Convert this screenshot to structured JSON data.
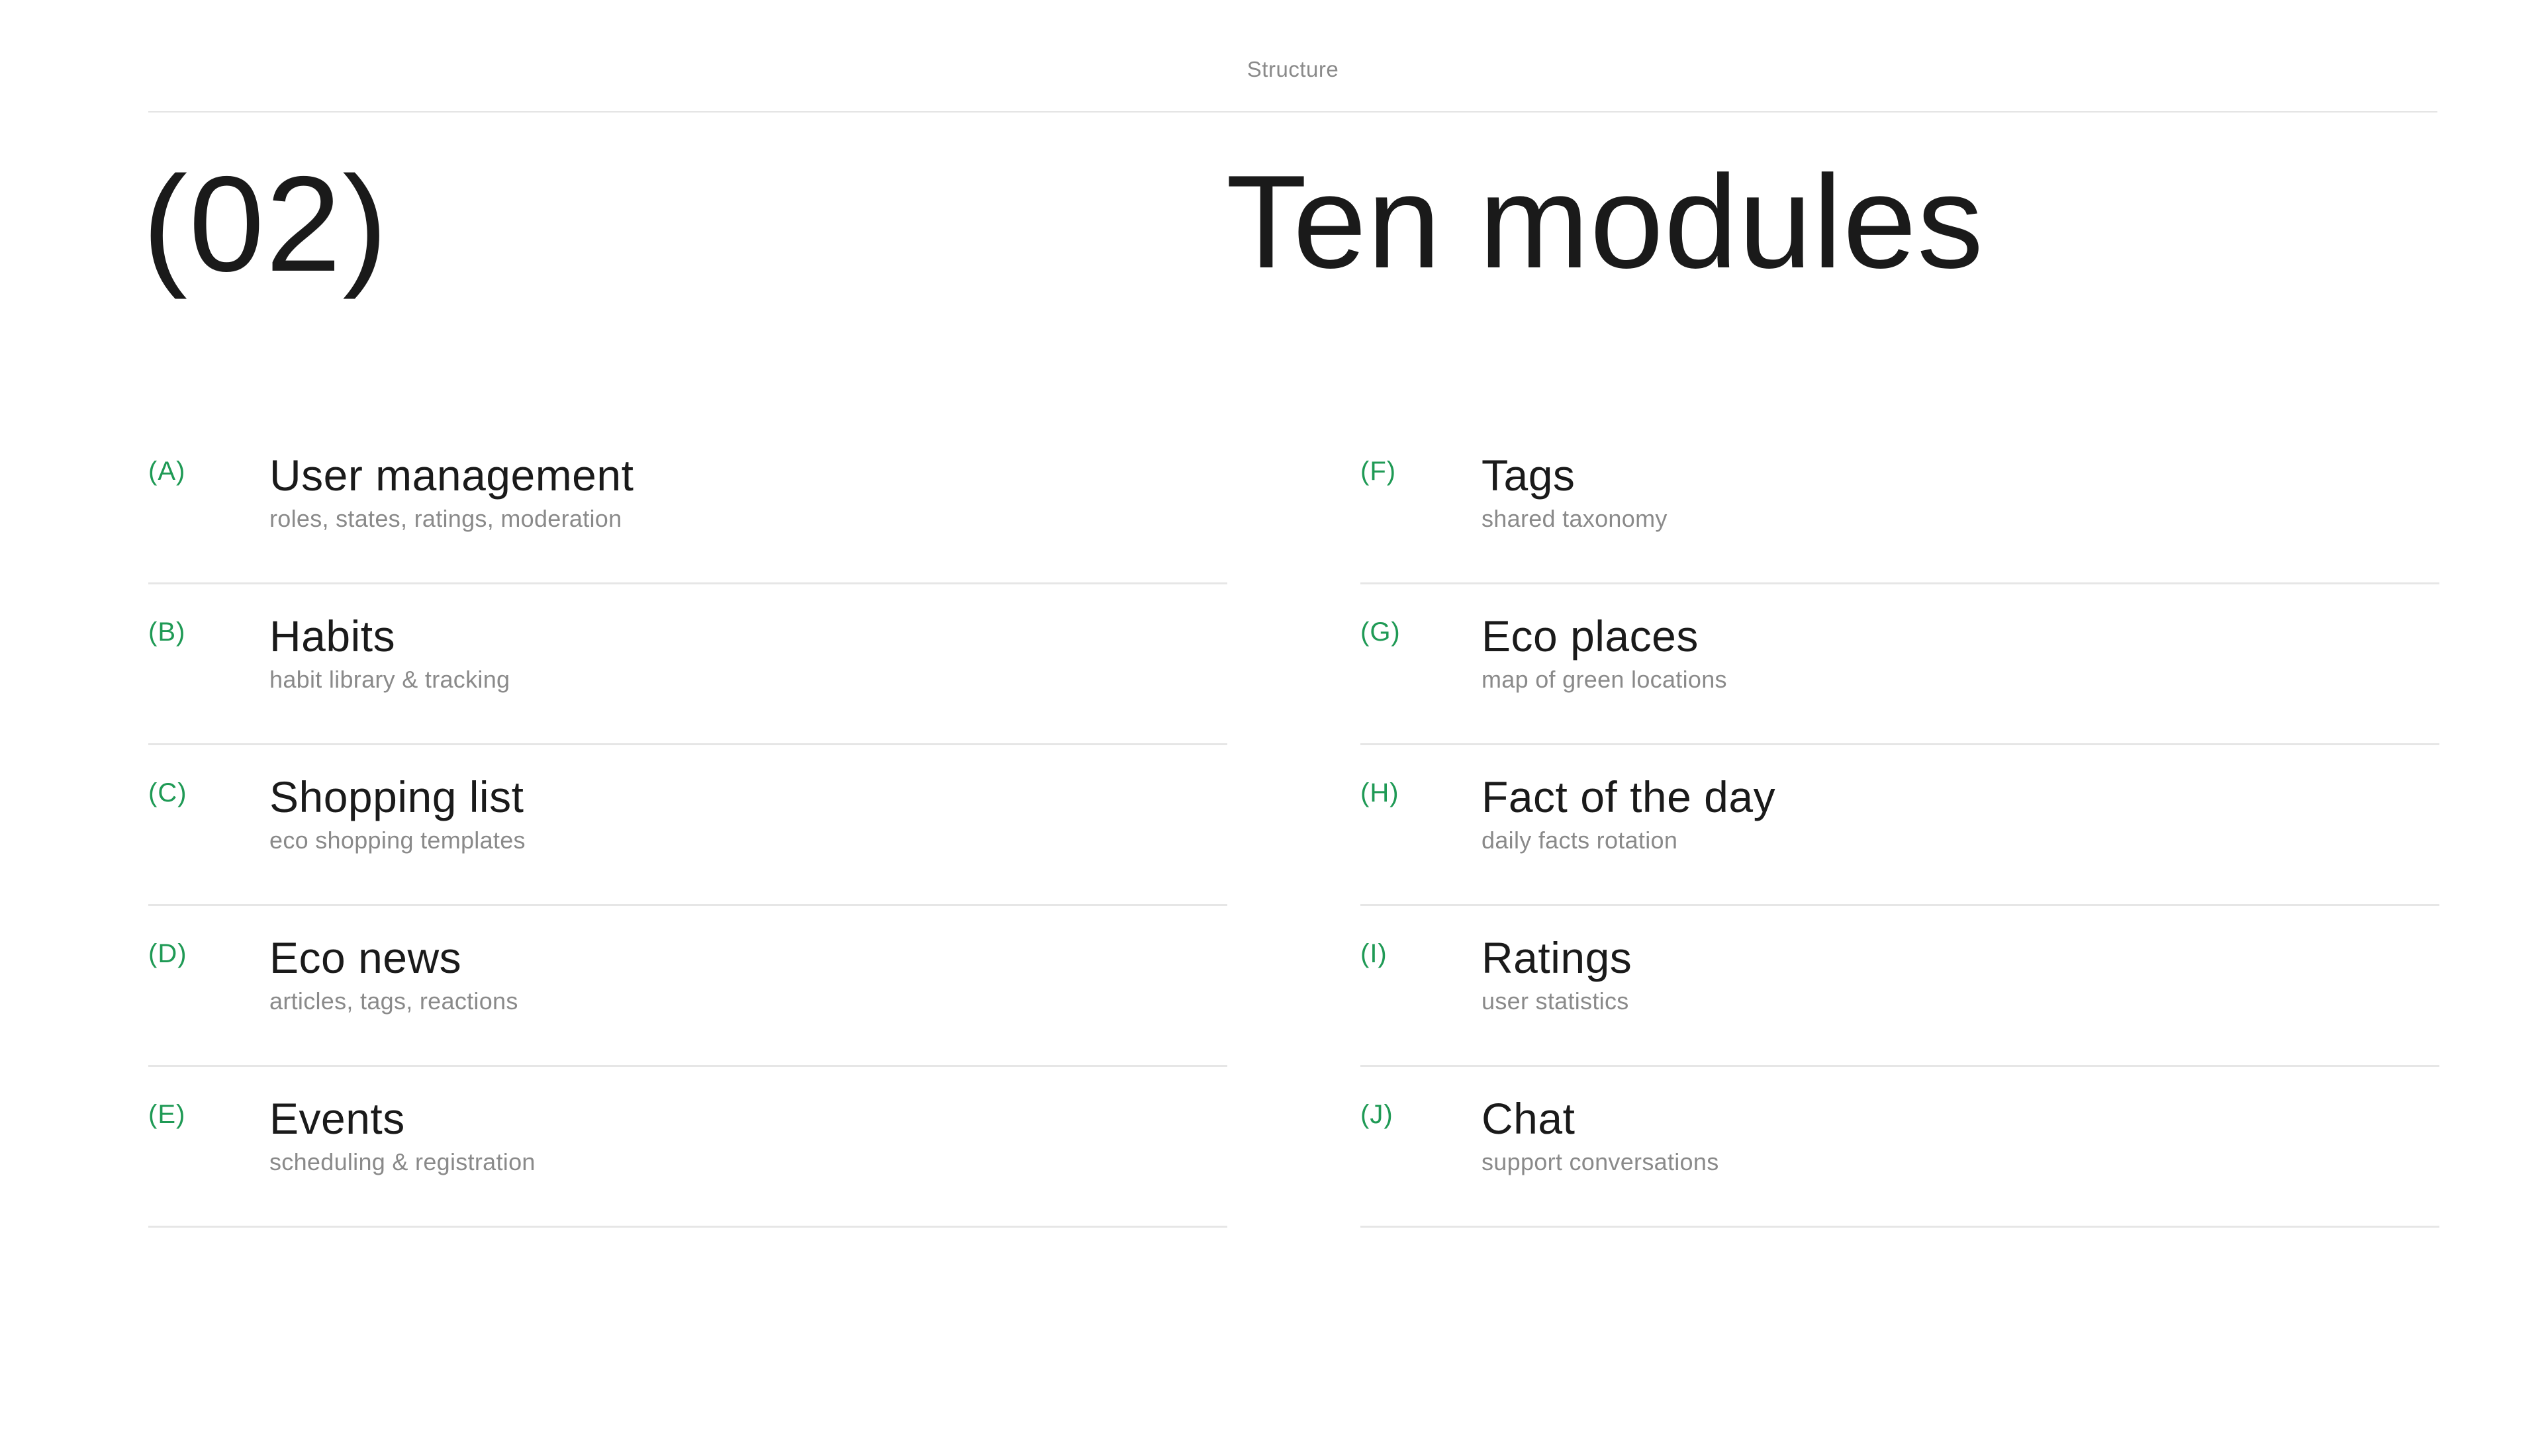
{
  "header": {
    "label": "Structure"
  },
  "section": {
    "number": "(02)",
    "title": "Ten modules"
  },
  "accent_color": "#1f9a55",
  "modules": {
    "left": [
      {
        "letter": "(A)",
        "title": "User management",
        "subtitle": "roles, states, ratings, moderation"
      },
      {
        "letter": "(B)",
        "title": "Habits",
        "subtitle": "habit library & tracking"
      },
      {
        "letter": "(C)",
        "title": "Shopping list",
        "subtitle": "eco shopping templates"
      },
      {
        "letter": "(D)",
        "title": "Eco news",
        "subtitle": "articles, tags, reactions"
      },
      {
        "letter": "(E)",
        "title": "Events",
        "subtitle": "scheduling & registration"
      }
    ],
    "right": [
      {
        "letter": "(F)",
        "title": "Tags",
        "subtitle": "shared taxonomy"
      },
      {
        "letter": "(G)",
        "title": "Eco places",
        "subtitle": "map of green locations"
      },
      {
        "letter": "(H)",
        "title": "Fact of the day",
        "subtitle": "daily facts rotation"
      },
      {
        "letter": "(I)",
        "title": "Ratings",
        "subtitle": "user statistics"
      },
      {
        "letter": "(J)",
        "title": "Chat",
        "subtitle": "support conversations"
      }
    ]
  }
}
